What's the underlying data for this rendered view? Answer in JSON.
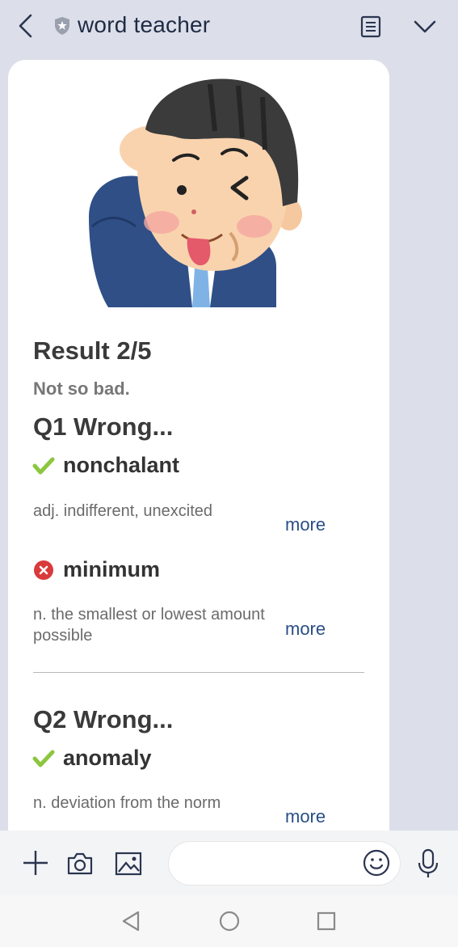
{
  "header": {
    "title": "word teacher",
    "back_icon": "chevron-left-icon",
    "badge_icon": "shield-star-icon",
    "notes_icon": "notes-icon",
    "expand_icon": "chevron-down-icon"
  },
  "result": {
    "title": "Result 2/5",
    "subtitle": "Not so bad."
  },
  "questions": [
    {
      "title": "Q1 Wrong...",
      "answers": [
        {
          "status": "correct",
          "word": "nonchalant",
          "definition": "adj. indifferent, unexcited",
          "more_label": "more"
        },
        {
          "status": "wrong",
          "word": "minimum",
          "definition": "n. the smallest or lowest amount possible",
          "more_label": "more"
        }
      ]
    },
    {
      "title": "Q2 Wrong...",
      "answers": [
        {
          "status": "correct",
          "word": "anomaly",
          "definition": "n. deviation from the norm",
          "more_label": "more"
        }
      ]
    }
  ],
  "input_bar": {
    "placeholder": "",
    "icons": [
      "plus-icon",
      "camera-icon",
      "image-icon",
      "emoji-icon",
      "microphone-icon"
    ]
  },
  "system_nav": {
    "icons": [
      "nav-back-icon",
      "nav-home-icon",
      "nav-recents-icon"
    ]
  },
  "colors": {
    "background": "#dcdfe9",
    "correct": "#8cc63f",
    "wrong": "#d93a3a",
    "link": "#2a4e86"
  }
}
